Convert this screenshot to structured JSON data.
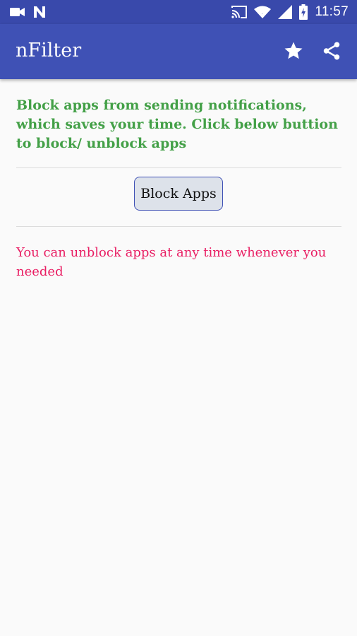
{
  "status_bar": {
    "time": "11:57",
    "icons": [
      "video-camera-icon",
      "n-logo-icon",
      "cast-icon",
      "wifi-icon",
      "cellular-signal-icon",
      "battery-charging-icon"
    ],
    "color": "#3949ab"
  },
  "app_bar": {
    "title": "nFilter",
    "color": "#3f51b5",
    "actions": [
      "star-icon",
      "share-icon"
    ]
  },
  "main": {
    "intro_text": "Block apps from sending notifications, which saves your time. Click below buttion to block/ unblock apps",
    "intro_color": "#43a047",
    "block_button_label": "Block Apps",
    "note_text": "You can unblock apps at any time whenever you needed",
    "note_color": "#e91e63"
  }
}
